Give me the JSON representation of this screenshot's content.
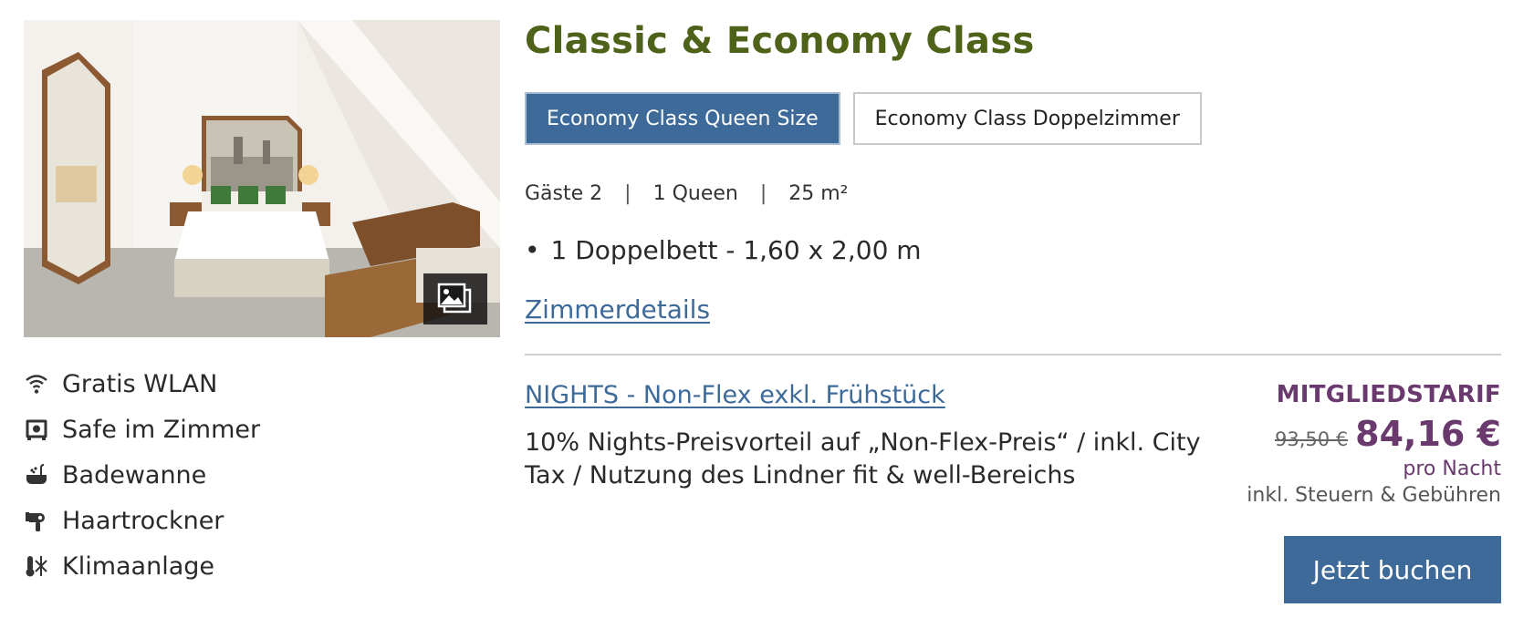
{
  "room": {
    "title": "Classic & Economy Class",
    "tabs": [
      {
        "label": "Economy Class Queen Size",
        "active": true
      },
      {
        "label": "Economy Class Doppelzimmer",
        "active": false
      }
    ],
    "specs": {
      "guests": "Gäste 2",
      "bed": "1 Queen",
      "size": "25 m²",
      "separator": "|"
    },
    "bullets": [
      "1 Doppelbett - 1,60 x 2,00 m"
    ],
    "details_link": "Zimmerdetails",
    "photo_alt": "Hotelzimmer mit Doppelbett",
    "gallery_icon": "gallery-icon"
  },
  "amenities": [
    {
      "icon": "wifi-icon",
      "label": "Gratis WLAN"
    },
    {
      "icon": "safe-icon",
      "label": "Safe im Zimmer"
    },
    {
      "icon": "bathtub-icon",
      "label": "Badewanne"
    },
    {
      "icon": "hairdryer-icon",
      "label": "Haartrockner"
    },
    {
      "icon": "air-conditioning-icon",
      "label": "Klimaanlage"
    }
  ],
  "rate": {
    "name": "NIGHTS - Non-Flex exkl. Frühstück",
    "description": "10% Nights-Preisvorteil auf „Non-Flex-Preis“ / inkl. City Tax / Nutzung des Lindner fit & well-Bereichs",
    "member_label": "MITGLIEDSTARIF",
    "old_price": "93,50 €",
    "price": "84,16 €",
    "per_night": "pro Nacht",
    "tax_note": "inkl. Steuern & Gebühren",
    "book_label": "Jetzt buchen"
  },
  "colors": {
    "title_green": "#4e6219",
    "accent_blue": "#3d6a99",
    "member_purple": "#6a3a6e"
  }
}
